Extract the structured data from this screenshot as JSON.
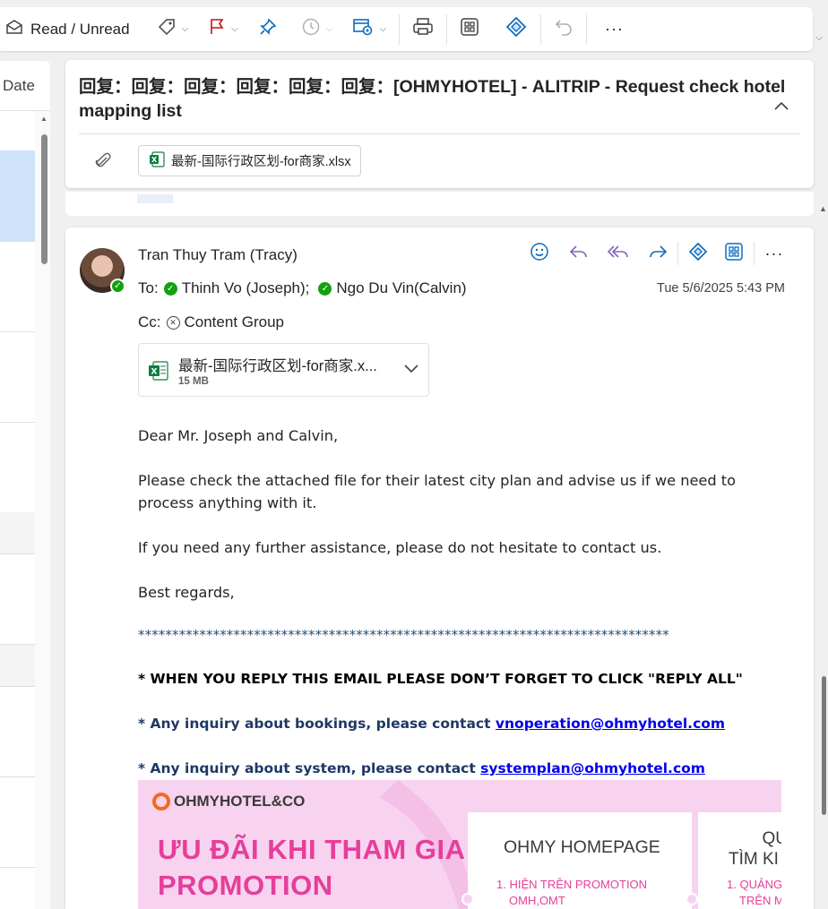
{
  "toolbar": {
    "read_unread_label": "Read / Unread",
    "icons": [
      "envelope-icon",
      "tag-icon",
      "flag-icon",
      "pin-icon",
      "snooze-icon",
      "rules-icon",
      "print-icon",
      "apps-icon",
      "loop-icon",
      "undo-icon",
      "more-icon"
    ]
  },
  "list": {
    "column_header": "Date"
  },
  "header": {
    "subject": "回复：回复：回复：回复：回复：回复：[OHMYHOTEL] - ALITRIP - Request check hotel mapping list",
    "attachment_name": "最新-国际行政区划-for商家.xlsx"
  },
  "message": {
    "sender": "Tran Thuy Tram (Tracy)",
    "to_label": "To:",
    "recipients": [
      "Thinh Vo (Joseph);",
      "Ngo Du Vin(Calvin)"
    ],
    "cc_label": "Cc:",
    "cc": "Content Group",
    "date": "Tue 5/6/2025 5:43 PM",
    "attachment": {
      "name": "最新-国际行政区划-for商家.x...",
      "size": "15 MB"
    },
    "body": {
      "greeting": "Dear Mr. Joseph and Calvin,",
      "para1": "Please check the attached file for their latest city plan and advise us if we need to process anything with it.",
      "para2": "If you need any further assistance, please do not hesitate to contact us.",
      "closing": "Best regards,",
      "stars": "******************************************************************************",
      "sig_reply_all": "* WHEN YOU REPLY THIS EMAIL PLEASE DON’T FORGET TO CLICK \"REPLY ALL\"",
      "sig_booking_prefix": "* Any inquiry about bookings, please contact ",
      "sig_booking_email": "vnoperation@ohmyhotel.com",
      "sig_system_prefix": "* Any inquiry about system, please contact ",
      "sig_system_email": "systemplan@ohmyhotel.com"
    },
    "banner": {
      "logo_text": "OHMYHOTEL&CO",
      "headline_1": "ƯU ĐÃI KHI THAM GIA",
      "headline_2": "PROMOTION",
      "panel1_title": "OHMY HOMEPAGE",
      "panel1_item": "1. HIỆN TRÊN PROMOTION",
      "panel1_item2": "OMH,OMT",
      "panel2_title_a": "QU",
      "panel2_title_b": "TÌM KI",
      "panel2_item": "1. QUẢNG",
      "panel2_item2": "TRÊN M"
    }
  },
  "colors": {
    "accent": "#0f6cbd",
    "reply_purple": "#8764b8",
    "presence_green": "#13a10e",
    "banner_pink": "#e63e9a"
  }
}
